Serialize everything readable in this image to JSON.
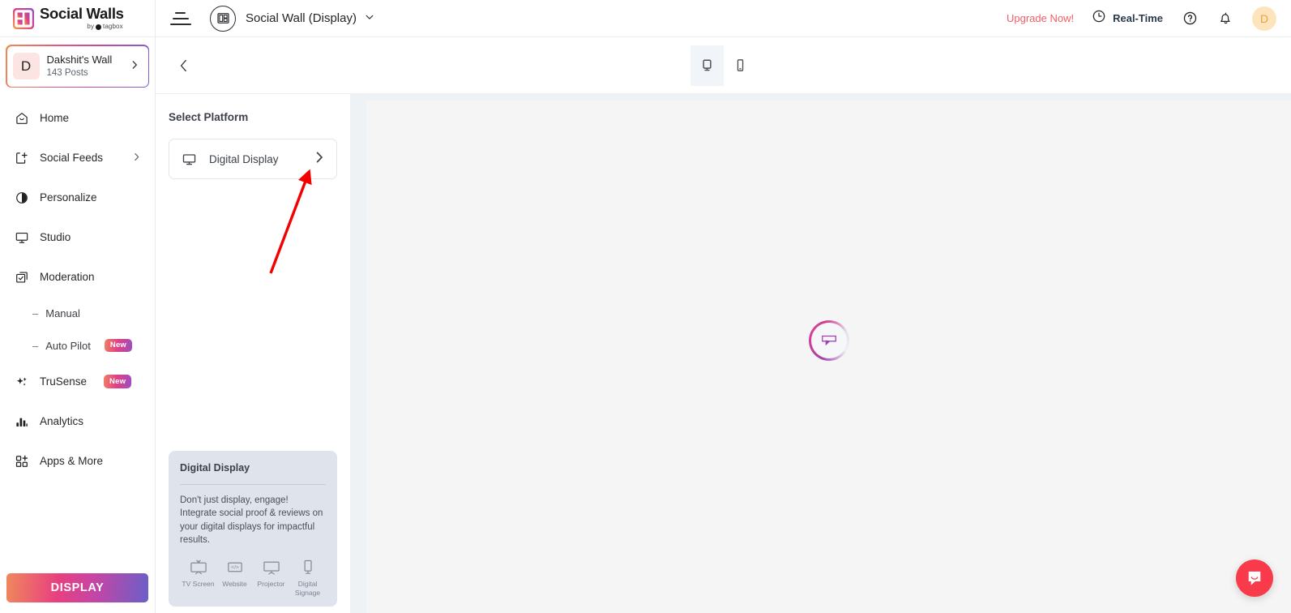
{
  "brand": {
    "title": "Social Walls",
    "subtitle": "by",
    "subtitle_brand": "tagbox"
  },
  "sidebar": {
    "wall": {
      "avatar_letter": "D",
      "name": "Dakshit's Wall",
      "posts": "143 Posts",
      "chevron": "chevron-right"
    },
    "items": [
      {
        "label": "Home",
        "icon": "home-icon",
        "has_chevron": false,
        "badge": null
      },
      {
        "label": "Social Feeds",
        "icon": "social-feeds-icon",
        "has_chevron": true,
        "badge": null
      },
      {
        "label": "Personalize",
        "icon": "personalize-icon",
        "has_chevron": false,
        "badge": null
      },
      {
        "label": "Studio",
        "icon": "studio-icon",
        "has_chevron": false,
        "badge": null
      },
      {
        "label": "Moderation",
        "icon": "moderation-icon",
        "has_chevron": false,
        "badge": null
      }
    ],
    "sub_items": [
      {
        "label": "Manual",
        "badge": null
      },
      {
        "label": "Auto Pilot",
        "badge": "New"
      }
    ],
    "items_lower": [
      {
        "label": "TruSense",
        "icon": "trusense-icon",
        "badge": "New"
      },
      {
        "label": "Analytics",
        "icon": "analytics-icon",
        "badge": null
      },
      {
        "label": "Apps & More",
        "icon": "apps-icon",
        "badge": null
      }
    ],
    "display_button": "DISPLAY"
  },
  "topbar": {
    "menu_icon": "hamburger-icon",
    "wall_type_icon": "layout-icon",
    "title": "Social Wall (Display)",
    "title_chevron": "chevron-down-icon",
    "upgrade": "Upgrade Now!",
    "realtime": "Real-Time",
    "realtime_icon": "clock-icon",
    "help_icon": "help-icon",
    "bell_icon": "bell-icon",
    "avatar_letter": "D"
  },
  "subbar": {
    "back_icon": "chevron-left-icon",
    "devices": [
      {
        "name": "desktop",
        "icon": "monitor-icon",
        "active": true
      },
      {
        "name": "mobile",
        "icon": "phone-icon",
        "active": false
      }
    ]
  },
  "platform_panel": {
    "title": "Select Platform",
    "card": {
      "label": "Digital Display",
      "icon": "monitor-icon",
      "chevron": "chevron-right-icon"
    },
    "info": {
      "title": "Digital Display",
      "text": "Don't just display, engage! Integrate social proof & reviews on your digital displays for impactful results.",
      "icons": [
        {
          "caption": "TV Screen",
          "icon": "tv-icon"
        },
        {
          "caption": "Website",
          "icon": "code-icon"
        },
        {
          "caption": "Projector",
          "icon": "projector-icon"
        },
        {
          "caption": "Digital Signage",
          "icon": "signage-icon"
        }
      ]
    }
  },
  "preview": {
    "loader_icon": "speech-bubble-loader"
  },
  "intercom": {
    "icon": "intercom-chat-icon"
  },
  "colors": {
    "accent_pink": "#e8407f",
    "accent_orange": "#f0885c",
    "accent_purple": "#6a5fc8",
    "upgrade_red": "#ef5f67",
    "intercom_red": "#f93a4a",
    "annotation_red": "#f40000",
    "panel_bg": "#eff2f5",
    "info_card_bg": "#dfe3ec"
  }
}
